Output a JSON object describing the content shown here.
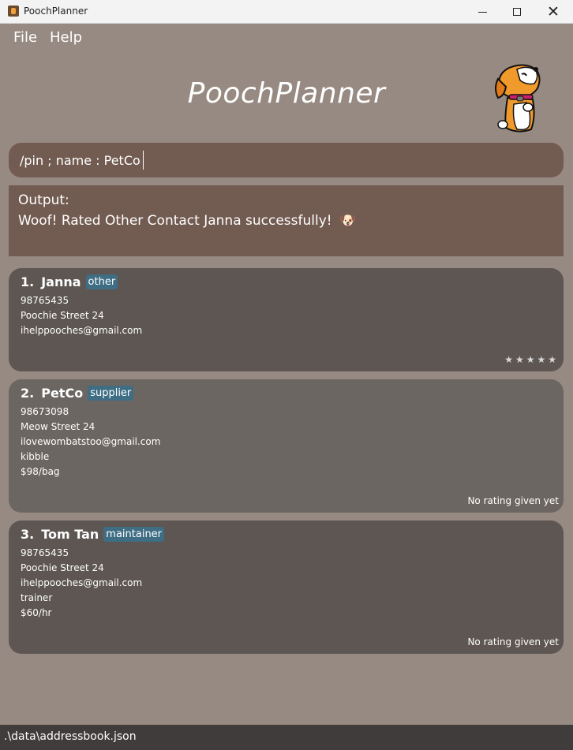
{
  "window": {
    "title": "PoochPlanner",
    "minimize_icon": "minimize-icon",
    "maximize_icon": "maximize-icon",
    "close_icon": "close-icon",
    "close_glyph": "✕"
  },
  "menu": {
    "items": [
      "File",
      "Help"
    ]
  },
  "header": {
    "title": "PoochPlanner",
    "mascot_icon": "dog-mascot-icon"
  },
  "command": {
    "value": "/pin ; name : PetCo"
  },
  "result": {
    "line1": "Output:",
    "line2": "Woof! Rated Other Contact Janna successfully!",
    "emoji": "🐶"
  },
  "contacts": [
    {
      "index": "1.",
      "name": "Janna",
      "tag": "other",
      "phone": "98765435",
      "address": "Poochie Street 24",
      "email": "ihelppooches@gmail.com",
      "extra": [],
      "rating_text": "",
      "stars": 5,
      "stars_display": "★★★★★"
    },
    {
      "index": "2.",
      "name": "PetCo",
      "tag": "supplier",
      "phone": "98673098",
      "address": "Meow Street 24",
      "email": "ilovewombatstoo@gmail.com",
      "extra": [
        "kibble",
        "$98/bag"
      ],
      "rating_text": "No rating given yet"
    },
    {
      "index": "3.",
      "name": "Tom Tan",
      "tag": "maintainer",
      "phone": "98765435",
      "address": "Poochie Street 24",
      "email": "ihelppooches@gmail.com",
      "extra": [
        "trainer",
        "$60/hr"
      ],
      "rating_text": "No rating given yet"
    }
  ],
  "status": {
    "path": ".\\data\\addressbook.json"
  },
  "colors": {
    "background": "#978a82",
    "panel": "#725b51",
    "card_dark": "#5d5652",
    "card_light": "#6c6662",
    "tag": "#3e6d84",
    "statusbar": "#403c3b"
  }
}
